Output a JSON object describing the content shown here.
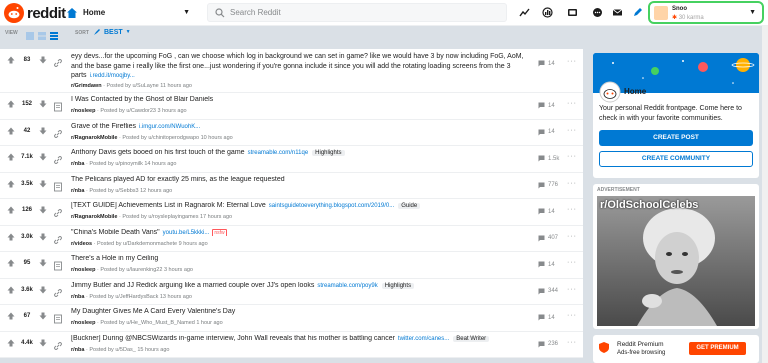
{
  "header": {
    "logo_text": "reddit",
    "home_label": "Home",
    "search_placeholder": "Search Reddit",
    "user": {
      "name": "Snoo",
      "karma": "30 karma"
    }
  },
  "viewbar": {
    "view_label": "VIEW",
    "sort_label": "SORT",
    "sort_value": "BEST"
  },
  "posts": [
    {
      "score": "83",
      "title": "eyy devs...for the upcoming FoG , can we choose which log in background we can set in game? like we would have 3 by now including FoG, AoM, and the base game i really like the first one...just wondering if you're gonna include it since you will add the rotating loading screens from the 3 parts",
      "link": "i.redd.it/moqjby...",
      "flair": "",
      "nsfw": "",
      "sub": "r/Grimdawn",
      "posted": " · Posted by u/SuLayne 11 hours ago",
      "comments": "14"
    },
    {
      "score": "152",
      "title": "I Was Contacted by the Ghost of Blair Daniels",
      "link": "",
      "flair": "",
      "nsfw": "",
      "sub": "r/nosleep",
      "posted": " · Posted by u/Cawdor23 3 hours ago",
      "comments": "14"
    },
    {
      "score": "42",
      "title": "Grave of the Fireflies",
      "link": "i.imgur.com/NWuohK...",
      "flair": "",
      "nsfw": "",
      "sub": "r/RagnarokMobile",
      "posted": " · Posted by u/chinitoperodgwapo 10 hours ago",
      "comments": "14"
    },
    {
      "score": "7.1k",
      "title": "Anthony Davis gets booed on his first touch of the game",
      "link": "streamable.com/n11qe",
      "flair": "Highlights",
      "nsfw": "",
      "sub": "r/nba",
      "posted": " · Posted by u/pinoymilk 14 hours ago",
      "comments": "1.5k"
    },
    {
      "score": "3.5k",
      "title": "The Pelicans played AD for exactly 25 mins, as the league requested",
      "link": "",
      "flair": "",
      "nsfw": "",
      "sub": "r/nba",
      "posted": " · Posted by u/Sebbs3 12 hours ago",
      "comments": "776"
    },
    {
      "score": "126",
      "title": "[TEXT GUIDE] Achievements List in Ragnarok M: Eternal Love",
      "link": "saintsguidetoeverything.blogspot.com/2019/0...",
      "flair": "Guide",
      "nsfw": "",
      "sub": "r/RagnarokMobile",
      "posted": " · Posted by u/roysleplayingames 17 hours ago",
      "comments": "14"
    },
    {
      "score": "3.0k",
      "title": "\"China's Mobile Death Vans\"",
      "link": "youtu.be/L5kkki...",
      "flair": "",
      "nsfw": "nsfw",
      "sub": "r/videos",
      "posted": " · Posted by u/Darkdemonmachete 9 hours ago",
      "comments": "407"
    },
    {
      "score": "95",
      "title": "There's a Hole in my Ceiling",
      "link": "",
      "flair": "",
      "nsfw": "",
      "sub": "r/nosleep",
      "posted": " · Posted by u/laurenking22 3 hours ago",
      "comments": "14"
    },
    {
      "score": "3.6k",
      "title": "Jimmy Butler and JJ Redick arguing like a married couple over JJ's open looks",
      "link": "streamable.com/poy9k",
      "flair": "Highlights",
      "nsfw": "",
      "sub": "r/nba",
      "posted": " · Posted by u/JeffHardysBack 13 hours ago",
      "comments": "344"
    },
    {
      "score": "67",
      "title": "My Daughter Gives Me A Card Every Valentine's Day",
      "link": "",
      "flair": "",
      "nsfw": "",
      "sub": "r/nosleep",
      "posted": " · Posted by u/He_Who_Must_B_Named 1 hour ago",
      "comments": "14"
    },
    {
      "score": "4.4k",
      "title": "[Buckner] During @NBCSWizards in-game interview, John Wall reveals that his mother is battling cancer",
      "link": "twitter.com/canes...",
      "flair": "Beat Writer",
      "nsfw": "",
      "sub": "r/nba",
      "posted": " · Posted by u/5Das_ 15 hours ago",
      "comments": "236"
    }
  ],
  "sidebar": {
    "home_title": "Home",
    "home_desc": "Your personal Reddit frontpage. Come here to check in with your favorite communities.",
    "create_post": "CREATE POST",
    "create_community": "CREATE COMMUNITY",
    "ad_label": "ADVERTISEMENT",
    "ad_caption": "r/OldSchoolCelebs",
    "premium_title": "Reddit Premium",
    "premium_sub": "Ads-free browsing",
    "premium_button": "GET PREMIUM"
  },
  "colors": {
    "brand": "#ff4500",
    "accent": "#0079d3",
    "highlight_border": "#46d160"
  }
}
